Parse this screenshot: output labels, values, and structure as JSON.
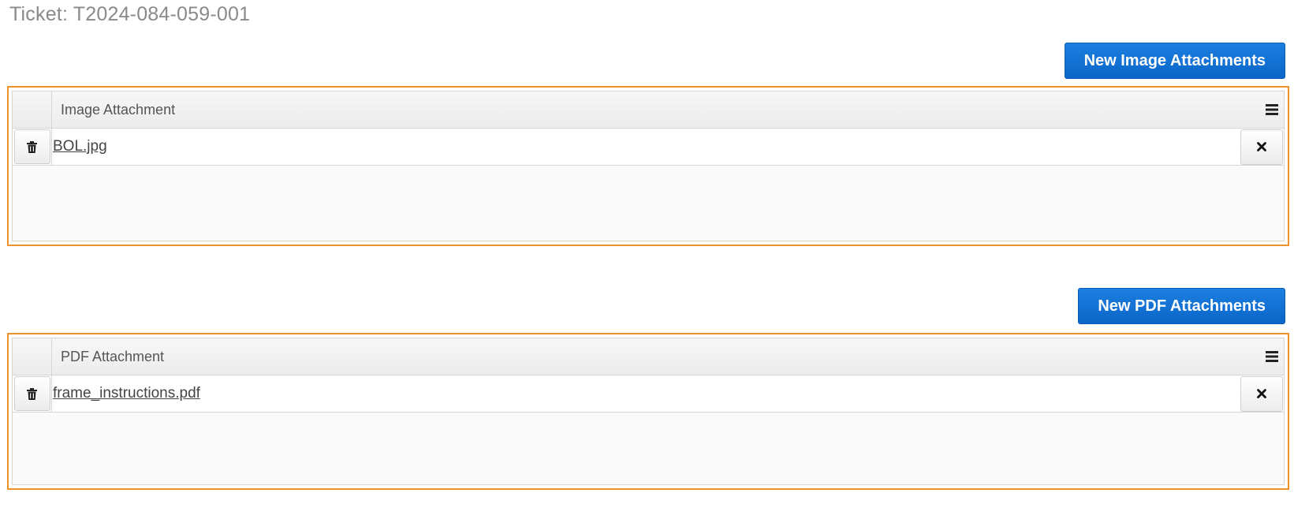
{
  "ticket": {
    "title": "Ticket: T2024-084-059-001"
  },
  "image_section": {
    "new_button_label": "New Image Attachments",
    "column_header": "Image Attachment",
    "rows": [
      {
        "file_name": "BOL.jpg"
      }
    ]
  },
  "pdf_section": {
    "new_button_label": "New PDF Attachments",
    "column_header": "PDF Attachment",
    "rows": [
      {
        "file_name": "frame_instructions.pdf"
      }
    ]
  },
  "icons": {
    "delete": "trash-icon",
    "remove": "close-icon",
    "menu": "hamburger-menu-icon"
  },
  "colors": {
    "accent_button": "#0a66c8",
    "highlight_border": "#f0922a"
  }
}
